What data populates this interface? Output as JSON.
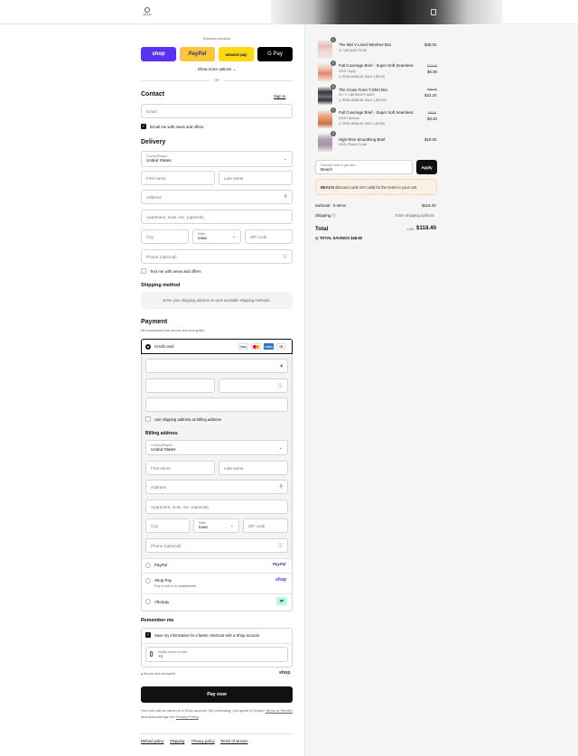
{
  "header": {
    "logo_text": "REVEAL",
    "cart_icon": "bag-icon"
  },
  "express": {
    "title": "Express checkout",
    "shop_label": "shop",
    "paypal_label": "PayPal",
    "amazon_label": "amazon pay",
    "gpay_label": "G Pay",
    "show_more": "Show more options",
    "or": "OR"
  },
  "contact": {
    "title": "Contact",
    "sign_in": "Sign in",
    "email_placeholder": "Email",
    "news_label": "Email me with news and offers"
  },
  "delivery": {
    "title": "Delivery",
    "country_label": "Country/Region",
    "country_value": "United States",
    "first_name": "First name",
    "last_name": "Last name",
    "address": "Address",
    "apartment": "Apartment, suite, etc. (optional)",
    "city": "City",
    "state_label": "State",
    "state_value": "Iowa",
    "zip": "ZIP code",
    "phone": "Phone (optional)",
    "text_label": "Text me with news and offers"
  },
  "shipping": {
    "title": "Shipping method",
    "message": "Enter your shipping address to view available shipping methods."
  },
  "payment": {
    "title": "Payment",
    "subtitle": "All transactions are secure and encrypted.",
    "credit_card": "Credit card",
    "more_cards": "+5",
    "use_shipping": "Use shipping address as billing address",
    "billing_title": "Billing address",
    "paypal": "PayPal",
    "paypal_logo": "PayPal",
    "shoppay": "Shop Pay",
    "shoppay_sub": "Pay in full or in installments",
    "shoppay_logo": "shop",
    "afterpay": "Afterpay"
  },
  "remember": {
    "title": "Remember me",
    "save_label": "Save my information for a faster checkout with a Shop account",
    "phone_label": "Mobile phone number",
    "phone_value": "+1",
    "secure": "Secure and encrypted",
    "shop_logo": "shop"
  },
  "pay_button": "Pay now",
  "terms": {
    "line1": "Your info will be saved to a Shop account. By continuing, you agree to Shop's",
    "tos": "Terms of Service",
    "and": "and acknowledge the",
    "privacy": "Privacy Policy",
    "period": "."
  },
  "footer": {
    "refund": "Refund policy",
    "shipping": "Shipping",
    "privacy": "Privacy policy",
    "tos": "Terms of service"
  },
  "order": {
    "items": [
      {
        "qty": "1",
        "name": "The Mid V Lined Wirefree Bra",
        "variant": "S / VINTAGE ROSE",
        "price": "$48.00",
        "orig": "",
        "sale": ""
      },
      {
        "qty": "1",
        "name": "Full Coverage Brief - Super Soft Seamless",
        "variant": "XS/S / Sp/ly",
        "price": "$6.00",
        "orig": "$15.00",
        "sale": "SEMI-ANNUAL SALE (-$9.00)"
      },
      {
        "qty": "1",
        "name": "The Cross Front T-Shirt Bra",
        "variant": "31 / C / MIDNIGHT NAVY",
        "price": "$23.20",
        "orig": "$58.00",
        "sale": "SEMI-ANNUAL SALE (-$34.80)"
      },
      {
        "qty": "1",
        "name": "Full Coverage Brief - Super Soft Seamless",
        "variant": "XS/S / Horizon",
        "price": "$3.20",
        "orig": "$8.00",
        "sale": "SEMI-ANNUAL SALE (-$4.80)"
      },
      {
        "qty": "1",
        "name": "High Rise Smoothing Brief",
        "variant": "XS/S / Purple Crush",
        "price": "$18.00",
        "orig": "",
        "sale": ""
      }
    ],
    "discount_label": "Discount code or gift card",
    "discount_value": "Beach",
    "apply": "Apply",
    "error_code": "BEACH",
    "error_text": "discount code isn't valid for the items in your cart",
    "subtotal_label": "Subtotal · 5 items",
    "subtotal": "$118.40",
    "shipping_label": "Shipping",
    "shipping_value": "Enter shipping address",
    "total_label": "Total",
    "currency": "USD",
    "total": "$118.40",
    "savings_label": "TOTAL SAVINGS",
    "savings": "$48.60"
  },
  "colors": {
    "shop": "#5a31f4",
    "paypal": "#ffc439",
    "amazon": "#ffd814",
    "error_bg": "#fdf0e4",
    "afterpay": "#b2fce4"
  }
}
